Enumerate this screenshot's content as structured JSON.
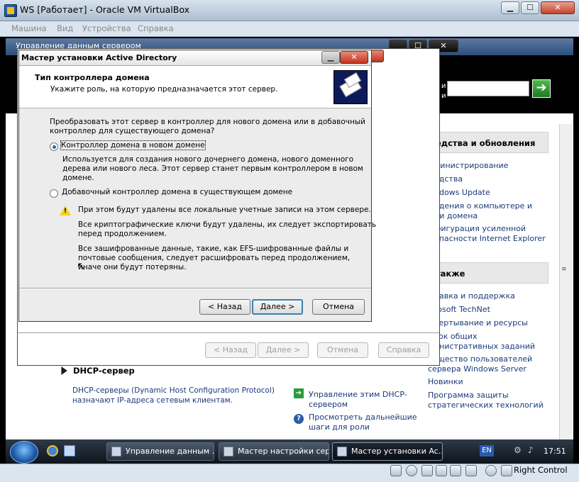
{
  "vbox": {
    "title": "WS [Работает] - Oracle VM VirtualBox",
    "menu": [
      "Машина",
      "Вид",
      "Устройства",
      "Справка"
    ],
    "status_right": "Right Control"
  },
  "server_window": {
    "title": "Управление данным сервером",
    "right_panel": {
      "tools_header": "едства и обновления",
      "tools_links": [
        "министрирование",
        "едства",
        "ndows Update",
        "едения о компьютере и\nни домена",
        "фигурация усиленной\nопасности Internet Explorer"
      ],
      "see_also_header": "также",
      "see_also_links": [
        "равка и поддержка",
        "rosoft TechNet",
        "вертывание и ресурсы",
        "сок общих\nинистративных заданий",
        "общество пользователей\nсервера Windows Server",
        "Новинки",
        "Программа защиты\nстратегических технологий"
      ]
    },
    "dhcp": {
      "title": "DHCP-сервер",
      "desc": "DHCP-серверы (Dynamic Host Configuration Protocol)\nназначают IP-адреса сетевым клиентам.",
      "manage_link": "Управление этим DHCP-\nсервером",
      "next_steps_link": "Просмотреть дальнейшие\nшаги для роли"
    }
  },
  "wizard_back_buttons": {
    "back": "< Назад",
    "next": "Далее >",
    "cancel": "Отмена",
    "help": "Справка"
  },
  "dialog": {
    "title": "Мастер установки Active Directory",
    "header_title": "Тип контроллера домена",
    "header_sub": "Укажите роль, на которую предназначается этот сервер.",
    "question": "Преобразовать этот сервер в контроллер для нового домена или в добавочный\nконтроллер для существующего домена?",
    "option1": "Контроллер домена в новом домене",
    "option1_desc": "Используется для создания нового дочернего домена, нового доменного\nдерева или нового леса. Этот сервер станет первым контроллером в новом\nдомене.",
    "option2": "Добавочный контроллер домена в существующем домене",
    "warn1": "При этом будут удалены все локальные учетные записи на этом сервере.",
    "warn2": "Все криптографические ключи будут удалены, их следует экспортировать\nперед продолжением.",
    "warn3": "Все зашифрованные данные, такие, как EFS-шифрованные файлы и\nпочтовые сообщения, следует расшифровать перед продолжением,\nиначе они будут потеряны.",
    "buttons": {
      "back": "< Назад",
      "next": "Далее >",
      "cancel": "Отмена"
    }
  },
  "taskbar": {
    "items": [
      "Управление данным ...",
      "Мастер настройки сер...",
      "Мастер установки Ac..."
    ],
    "lang": "EN",
    "time": "17:51"
  },
  "selection": {
    "option": 1
  }
}
